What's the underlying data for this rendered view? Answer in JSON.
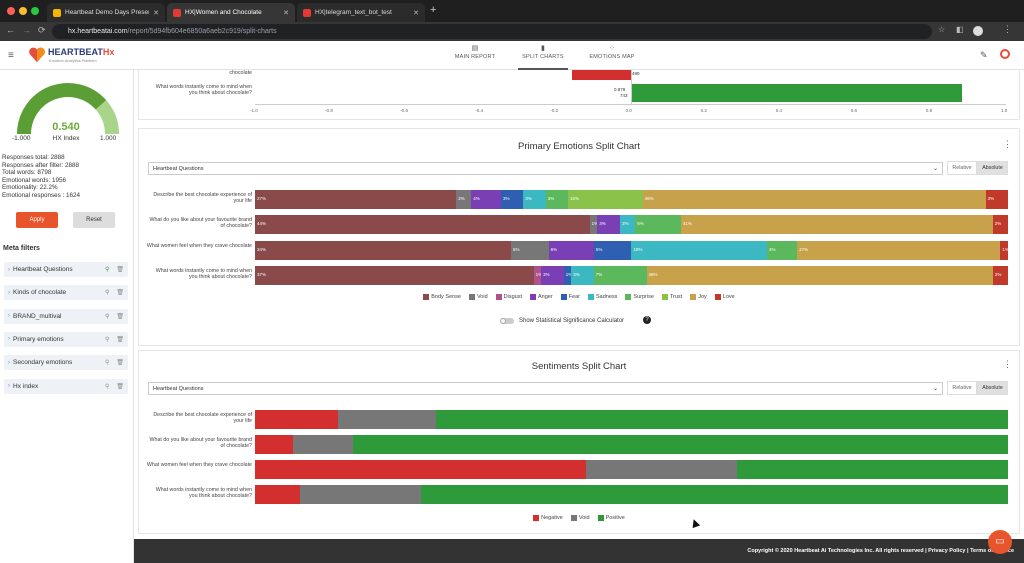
{
  "browser": {
    "tabs": [
      {
        "label": "Heartbeat Demo Days Present",
        "active": false,
        "color": "#f4b400"
      },
      {
        "label": "HX|Women and Chocolate",
        "active": true,
        "color": "#e53935"
      },
      {
        "label": "HX|telegram_text_bot_test",
        "active": false,
        "color": "#e53935"
      }
    ],
    "url_domain": "hx.heartbeatai.com",
    "url_path": "/report/5d94fb604e6850a6aeb2c919/split-charts"
  },
  "app": {
    "logo_text": "HEARTBEAT",
    "logo_suffix": "Hx",
    "logo_tagline": "Emotion Analytics Platform",
    "nav": [
      "MAIN REPORT",
      "SPLIT CHARTS",
      "EMOTIONS MAP"
    ]
  },
  "sidebar": {
    "gauge": {
      "value": "0.540",
      "label": "HX Index",
      "min": "-1.000",
      "max": "1.000",
      "fraction": 0.77
    },
    "stats": [
      "Responses total: 2888",
      "Responses after filter: 2888",
      "Total words: 8798",
      "Emotional words: 1956",
      "Emotionality: 22.2%",
      "Emotional responses : 1624"
    ],
    "apply_label": "Apply",
    "reset_label": "Reset",
    "meta_title": "Meta filters",
    "filters": [
      "Heartbeat Questions",
      "Kinds of chocolate",
      "BRAND_multival",
      "Primary emotions",
      "Secondary emotions",
      "Hx index"
    ]
  },
  "top_chart": {
    "labels": [
      "chocolate",
      "What words instantly come to mind when you think about chocolate?"
    ],
    "values_text": [
      "489",
      "0.878",
      "743"
    ],
    "ticks": [
      "-1.0",
      "-0.8",
      "-0.6",
      "-0.4",
      "-0.2",
      "0.0",
      "0.2",
      "0.4",
      "0.6",
      "0.8",
      "1.0"
    ]
  },
  "emotions_panel": {
    "title": "Primary Emotions Split Chart",
    "dropdown": "Heartbeat Questions",
    "relative_label": "Relative",
    "absolute_label": "Absolute",
    "toggle_label": "Show Statistical Significance Calculator",
    "help_icon": "?"
  },
  "sentiments_panel": {
    "title": "Sentiments Split Chart",
    "dropdown": "Heartbeat Questions",
    "relative_label": "Relative",
    "absolute_label": "Absolute"
  },
  "chart_data": [
    {
      "type": "bar",
      "stacked": true,
      "orientation": "horizontal",
      "title": "Primary Emotions Split Chart",
      "categories": [
        "Describe the best chocolate experience of your life",
        "What do you like about your favourite brand of chocolate?",
        "What women feel when they crave chocolate",
        "What words instantly come to mind when you think about chocolate?"
      ],
      "series": [
        {
          "name": "Body Sense",
          "color": "#8b4a4a",
          "values": [
            27,
            44,
            34,
            37
          ],
          "labels": [
            "27%",
            "44%",
            "34%",
            "37%"
          ]
        },
        {
          "name": "Void",
          "color": "#777777",
          "values": [
            2,
            1,
            5,
            0
          ],
          "labels": [
            "2%",
            "1%",
            "5%",
            ""
          ]
        },
        {
          "name": "Disgust",
          "color": "#b0528a",
          "values": [
            0,
            0,
            0,
            1
          ],
          "labels": [
            "",
            "",
            "",
            "1%"
          ]
        },
        {
          "name": "Anger",
          "color": "#7a3fb5",
          "values": [
            4,
            3,
            6,
            3
          ],
          "labels": [
            "4%",
            "3%",
            "6%",
            "3%"
          ]
        },
        {
          "name": "Fear",
          "color": "#2e5fb0",
          "values": [
            3,
            0,
            5,
            1
          ],
          "labels": [
            "3%",
            "",
            "5%",
            "1%"
          ]
        },
        {
          "name": "Sadness",
          "color": "#3bb8c2",
          "values": [
            3,
            2,
            18,
            3
          ],
          "labels": [
            "3%",
            "2%",
            "18%",
            "3%"
          ]
        },
        {
          "name": "Surprise",
          "color": "#5cb85c",
          "values": [
            3,
            6,
            4,
            7
          ],
          "labels": [
            "3%",
            "6%",
            "4%",
            "7%"
          ]
        },
        {
          "name": "Trust",
          "color": "#8bc34a",
          "values": [
            10,
            0,
            0,
            0
          ],
          "labels": [
            "10%",
            "",
            "",
            ""
          ]
        },
        {
          "name": "Joy",
          "color": "#c8a24a",
          "values": [
            46,
            41,
            27,
            46
          ],
          "labels": [
            "46%",
            "41%",
            "27%",
            "46%"
          ]
        },
        {
          "name": "Love",
          "color": "#c0392b",
          "values": [
            3,
            2,
            1,
            2
          ],
          "labels": [
            "3%",
            "2%",
            "1%",
            "2%"
          ]
        }
      ]
    },
    {
      "type": "bar",
      "stacked": true,
      "orientation": "horizontal",
      "title": "Sentiments Split Chart",
      "categories": [
        "Describe the best chocolate experience of your life",
        "What do you like about your favourite brand of chocolate?",
        "What women feel when they crave chocolate",
        "What words instantly come to mind when you think about chocolate?"
      ],
      "series": [
        {
          "name": "Negative",
          "color": "#d32f2f",
          "values": [
            11,
            5,
            44,
            6
          ]
        },
        {
          "name": "Void",
          "color": "#777777",
          "values": [
            13,
            8,
            20,
            16
          ]
        },
        {
          "name": "Positive",
          "color": "#2e9a3a",
          "values": [
            76,
            87,
            36,
            78
          ]
        }
      ]
    }
  ],
  "footer": {
    "copyright": "Copyright © 2020 Heartbeat Ai Technologies Inc. All rights reserved | Privacy Policy | Terms of Service"
  }
}
